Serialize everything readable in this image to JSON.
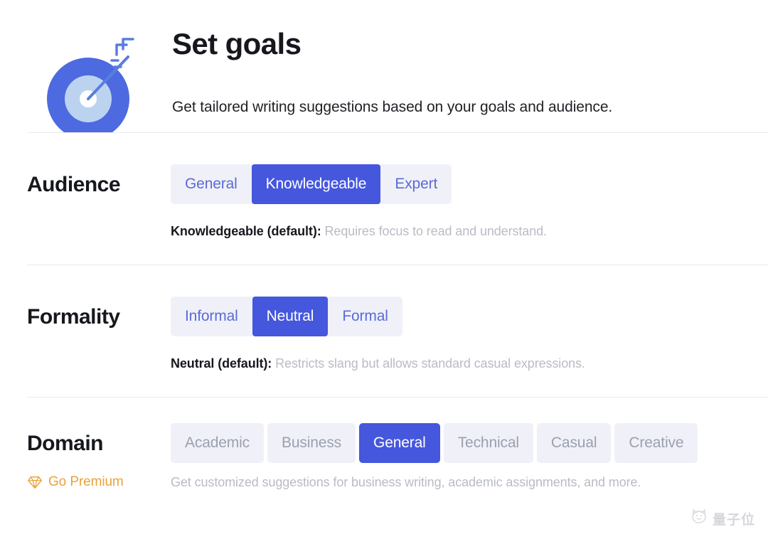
{
  "header": {
    "icon": "target-with-arrow-icon",
    "title": "Set goals",
    "subtitle": "Get tailored writing suggestions based on your goals and audience."
  },
  "colors": {
    "accent_selected": "#4557dd",
    "segment_background": "#f0f1f8",
    "segment_text": "#5a6ad8",
    "segment_text_disabled": "#9ba0ae",
    "hint_text": "#b9bcc4",
    "premium_gold": "#e9a23b",
    "divider": "#e8eaee"
  },
  "sections": [
    {
      "label": "Audience",
      "options": [
        "General",
        "Knowledgeable",
        "Expert"
      ],
      "selected": "Knowledgeable",
      "hint_bold": "Knowledgeable (default):",
      "hint_rest": " Requires focus to read and understand.",
      "locked": false
    },
    {
      "label": "Formality",
      "options": [
        "Informal",
        "Neutral",
        "Formal"
      ],
      "selected": "Neutral",
      "hint_bold": "Neutral (default):",
      "hint_rest": " Restricts slang but allows standard casual expressions.",
      "locked": false
    },
    {
      "label": "Domain",
      "options": [
        "Academic",
        "Business",
        "General",
        "Technical",
        "Casual",
        "Creative"
      ],
      "selected": "General",
      "hint_bold": "",
      "hint_rest": "Get customized suggestions for business writing, academic assignments, and more.",
      "locked": true
    }
  ],
  "premium": {
    "icon": "diamond-icon",
    "label": "Go Premium",
    "hint": "Get customized suggestions for business writing, academic assignments, and more."
  },
  "watermark": {
    "icon": "cat-face-icon",
    "text": "量子位"
  }
}
